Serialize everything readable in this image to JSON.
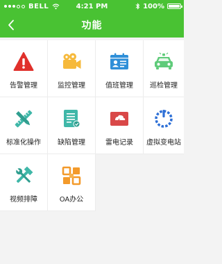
{
  "status_bar": {
    "carrier": "BELL",
    "time": "4:21 PM",
    "battery": "100%",
    "battery_level": 1.0
  },
  "header": {
    "title": "功能"
  },
  "functions": [
    {
      "label": "告警管理",
      "icon": "alarm-warning-icon"
    },
    {
      "label": "监控管理",
      "icon": "video-camera-icon"
    },
    {
      "label": "值班管理",
      "icon": "duty-id-card-icon"
    },
    {
      "label": "巡检管理",
      "icon": "patrol-car-icon"
    },
    {
      "label": "标准化操作",
      "icon": "pencil-ruler-icon"
    },
    {
      "label": "缺陷管理",
      "icon": "defect-document-icon"
    },
    {
      "label": "雷电记录",
      "icon": "lightning-record-icon"
    },
    {
      "label": "虚拟变电站",
      "icon": "virtual-substation-icon"
    },
    {
      "label": "视频排障",
      "icon": "troubleshooting-tools-icon"
    },
    {
      "label": "OA办公",
      "icon": "oa-office-icon"
    }
  ],
  "colors": {
    "primary_green": "#49c233",
    "alarm_red": "#e0302b",
    "camera_yellow": "#f6b93b",
    "duty_blue": "#2f8fd8",
    "car_green": "#5fcb7a",
    "tool_teal": "#3fb7a8",
    "record_red": "#d94848",
    "ring_blue": "#2d6fd6",
    "oa_orange": "#f39a2b"
  }
}
